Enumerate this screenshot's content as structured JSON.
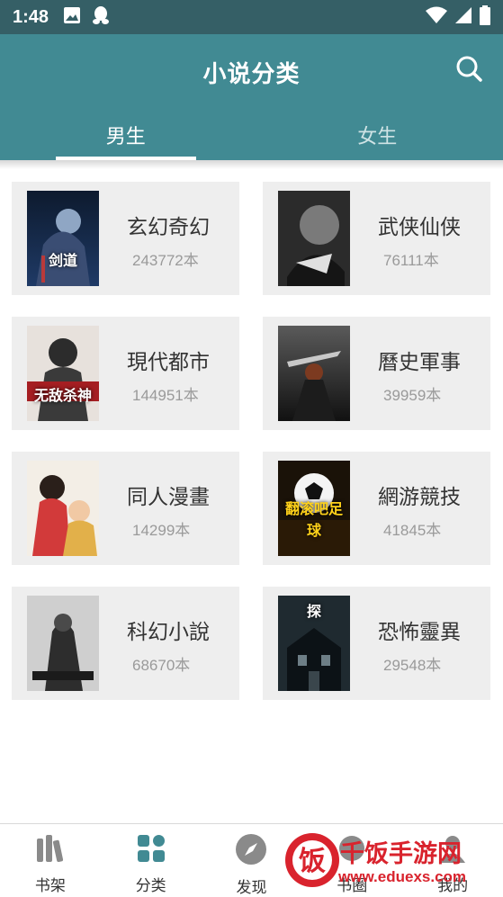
{
  "status_bar": {
    "time": "1:48"
  },
  "header": {
    "title": "小说分类"
  },
  "tabs": [
    {
      "label": "男生"
    },
    {
      "label": "女生"
    }
  ],
  "categories": [
    {
      "name": "玄幻奇幻",
      "count": "243772本",
      "cover_title": "剑道"
    },
    {
      "name": "武侠仙侠",
      "count": "76111本",
      "cover_title": ""
    },
    {
      "name": "現代都市",
      "count": "144951本",
      "cover_title": "无敌杀神"
    },
    {
      "name": "曆史軍事",
      "count": "39959本",
      "cover_title": ""
    },
    {
      "name": "同人漫畫",
      "count": "14299本",
      "cover_title": ""
    },
    {
      "name": "網游競技",
      "count": "41845本",
      "cover_title": "翻滚吧足球"
    },
    {
      "name": "科幻小說",
      "count": "68670本",
      "cover_title": ""
    },
    {
      "name": "恐怖靈異",
      "count": "29548本",
      "cover_title": "探"
    }
  ],
  "bottom_nav": [
    {
      "label": "书架",
      "icon": "bookshelf-icon"
    },
    {
      "label": "分类",
      "icon": "category-icon"
    },
    {
      "label": "发现",
      "icon": "compass-icon"
    },
    {
      "label": "书圈",
      "icon": "circle-icon"
    },
    {
      "label": "我的",
      "icon": "profile-icon"
    }
  ],
  "watermark": {
    "text": "千饭手游网",
    "url": "www.eduexs.com",
    "logo_char": "饭"
  },
  "colors": {
    "status_bar": "#355f66",
    "header": "#418a93",
    "card": "#eeeeee",
    "nav_active": "#418a93",
    "nav_inactive": "#8a8a8a"
  }
}
